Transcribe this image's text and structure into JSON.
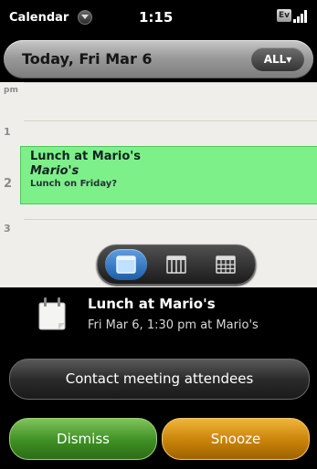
{
  "status_bar": {
    "app_name": "Calendar",
    "time": "1:15",
    "network_badge": "Ev",
    "icons": [
      "chevron-down-icon",
      "signal-bars-icon"
    ]
  },
  "header": {
    "title": "Today, Fri Mar 6",
    "filter_label": "ALL▾"
  },
  "calendar": {
    "hour_labels": [
      "pm",
      "1",
      "2",
      "3"
    ],
    "event": {
      "title": "Lunch at Mario's",
      "location": "Mario's",
      "note": "Lunch on Friday?",
      "color": "#7ef08a"
    },
    "views": [
      {
        "name": "day",
        "icon": "day-view-icon",
        "selected": true
      },
      {
        "name": "week",
        "icon": "week-view-icon",
        "selected": false
      },
      {
        "name": "month",
        "icon": "month-view-icon",
        "selected": false
      }
    ]
  },
  "reminder": {
    "icon": "calendar-icon",
    "title": "Lunch at Mario's",
    "subtitle": "Fri Mar 6, 1:30 pm at Mario's"
  },
  "actions": {
    "contact_label": "Contact meeting attendees",
    "dismiss_label": "Dismiss",
    "snooze_label": "Snooze",
    "dismiss_color": "#4a9a2c",
    "snooze_color": "#d08a0a"
  }
}
